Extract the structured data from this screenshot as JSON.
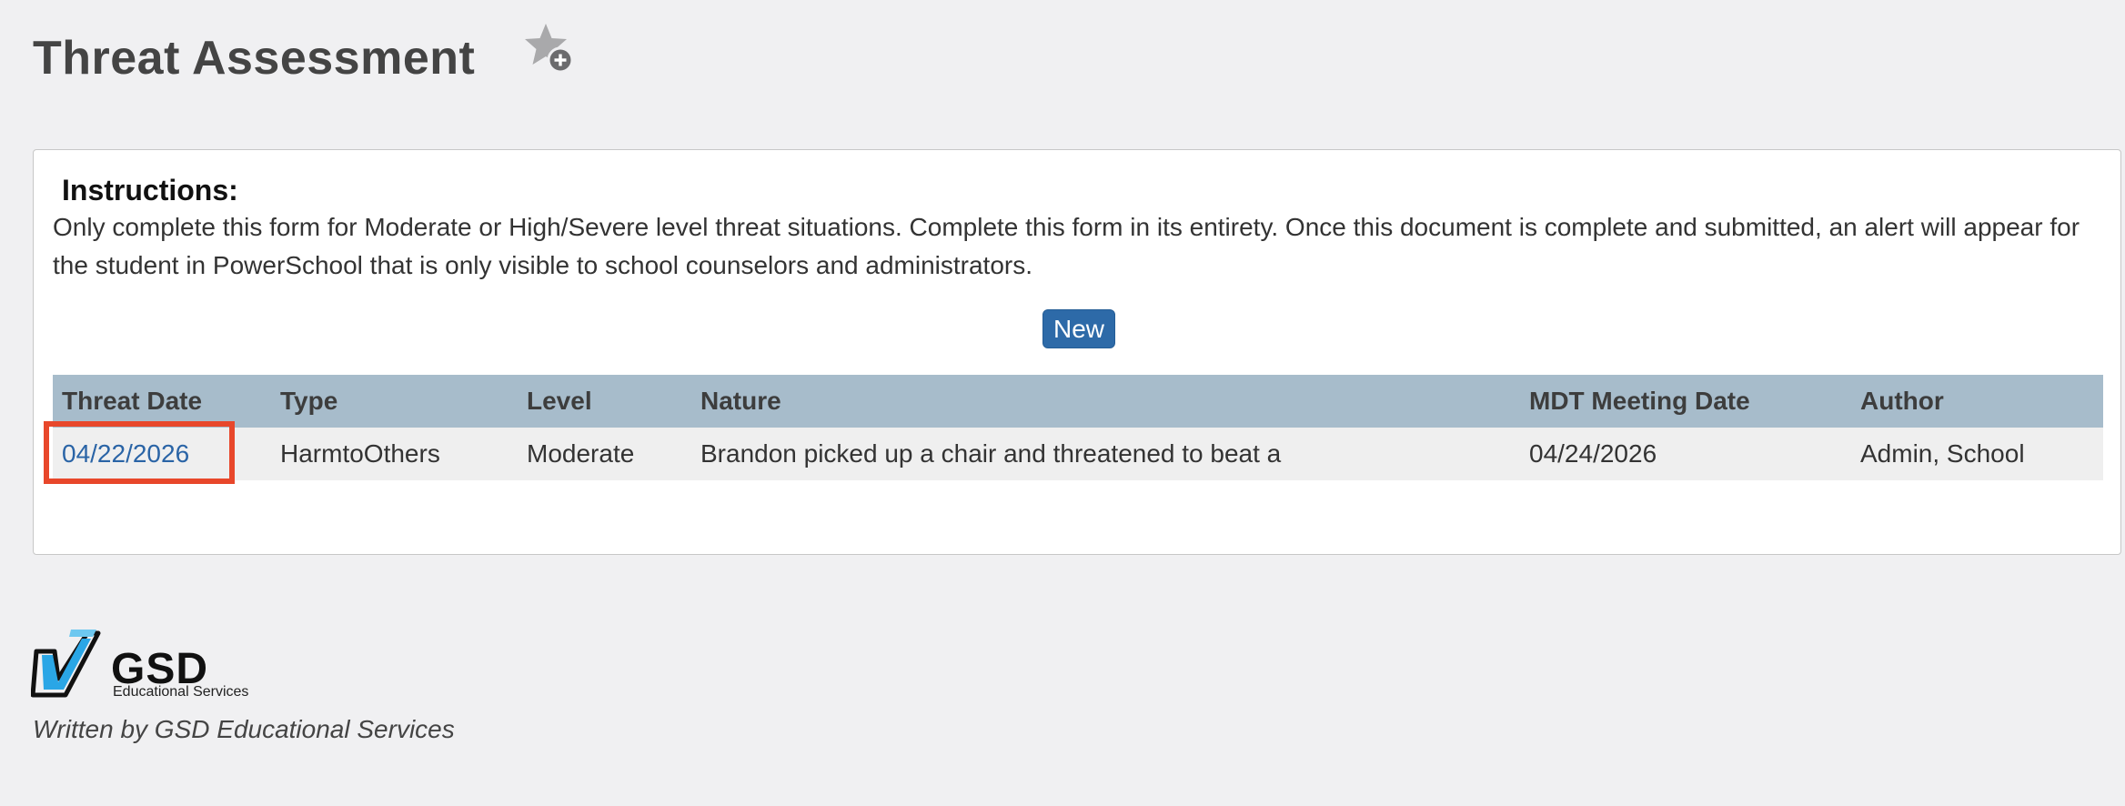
{
  "header": {
    "title": "Threat Assessment",
    "favorite_icon": "star-plus-icon"
  },
  "instructions": {
    "heading": "Instructions:",
    "text": "Only complete this form for Moderate or High/Severe level threat situations. Complete this form in its entirety. Once this document is complete and submitted, an alert will appear for the student in PowerSchool that is only visible to school counselors and administrators."
  },
  "actions": {
    "new_label": "New"
  },
  "table": {
    "columns": [
      "Threat Date",
      "Type",
      "Level",
      "Nature",
      "MDT Meeting Date",
      "Author"
    ],
    "rows": [
      {
        "threat_date": "04/22/2026",
        "type": "HarmtoOthers",
        "level": "Moderate",
        "nature": "Brandon picked up a chair and threatened to beat a",
        "mdt_meeting_date": "04/24/2026",
        "author": "Admin, School"
      }
    ]
  },
  "footer": {
    "logo_name": "GSD",
    "logo_subtitle": "Educational Services",
    "written_by": "Written by GSD Educational Services"
  },
  "colors": {
    "title": "#444444",
    "button": "#2d6aa8",
    "table_header": "#a7bccb",
    "link": "#2a64a6",
    "highlight": "#e8472b"
  }
}
